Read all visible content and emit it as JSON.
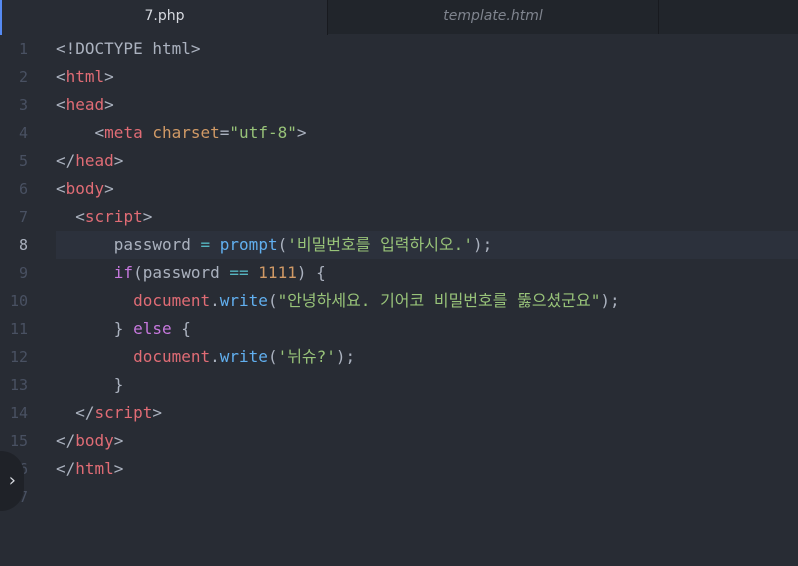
{
  "tabs": {
    "active": "7.php",
    "inactive": "template.html"
  },
  "gutter": {
    "numbers": [
      "1",
      "2",
      "3",
      "4",
      "5",
      "6",
      "7",
      "8",
      "9",
      "10",
      "11",
      "12",
      "13",
      "14",
      "15",
      "16",
      "17"
    ],
    "current_line": "8"
  },
  "code": {
    "l1": [
      "<!DOCTYPE html>"
    ],
    "l2": [
      "<",
      "html",
      ">"
    ],
    "l3": [
      "<",
      "head",
      ">"
    ],
    "l4": [
      "    <",
      "meta",
      " ",
      "charset",
      "=",
      "\"utf-8\"",
      ">"
    ],
    "l5": [
      "</",
      "head",
      ">"
    ],
    "l6": [
      "<",
      "body",
      ">"
    ],
    "l7": [
      "  <",
      "script",
      ">"
    ],
    "l8": [
      "      password ",
      "=",
      " ",
      "prompt",
      "(",
      "'비밀번호를 입력하시오.'",
      ");"
    ],
    "l9": [
      "      ",
      "if",
      "(password ",
      "==",
      " ",
      "1111",
      ") {"
    ],
    "l10": [
      "        ",
      "document",
      ".",
      "write",
      "(",
      "\"안녕하세요. 기어코 비밀번호를 뚫으셨군요\"",
      ");"
    ],
    "l11": [
      "      } ",
      "else",
      " {"
    ],
    "l12": [
      "        ",
      "document",
      ".",
      "write",
      "(",
      "'뉘슈?'",
      ");"
    ],
    "l13": [
      "      }"
    ],
    "l14": [
      "  </",
      "script",
      ">"
    ],
    "l15": [
      "</",
      "body",
      ">"
    ],
    "l16": [
      "</",
      "html",
      ">"
    ],
    "l17": [
      ""
    ]
  },
  "panel_toggle": {
    "icon": "chevron-right-icon",
    "glyph": "›"
  }
}
